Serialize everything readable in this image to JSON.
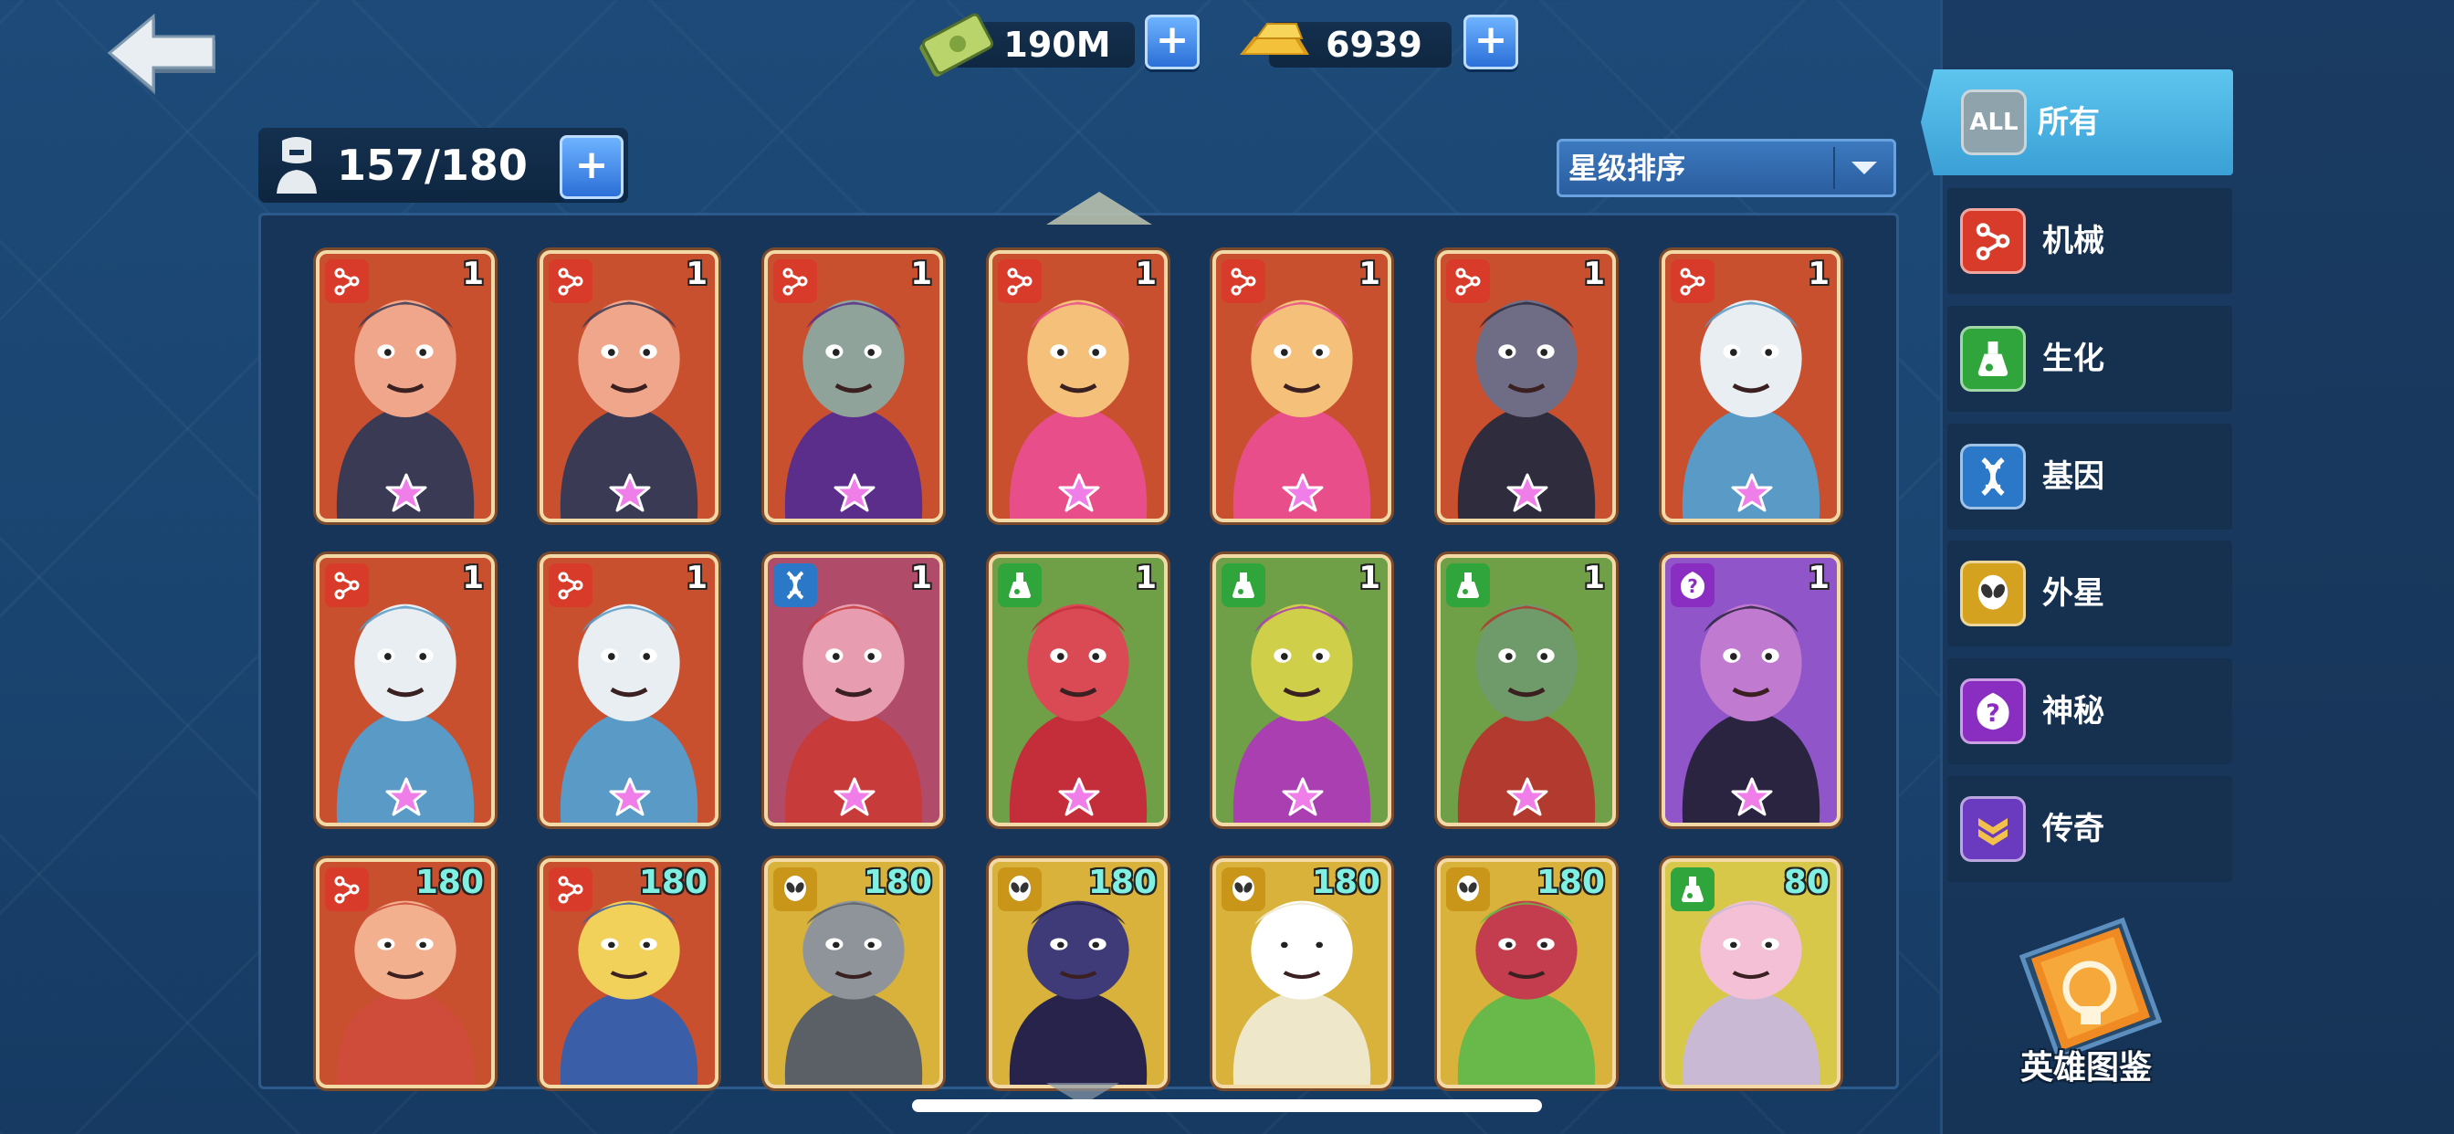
{
  "currencies": [
    {
      "name": "cash",
      "value": "190M",
      "icon": "cash-icon"
    },
    {
      "name": "gold",
      "value": "6939",
      "icon": "gold-bars-icon"
    }
  ],
  "capacity": {
    "value": "157/180",
    "icon": "hero-bust-icon"
  },
  "sort": {
    "label": "星级排序"
  },
  "tabs": [
    {
      "id": "all",
      "label": "所有",
      "icon": "all-icon",
      "icon_text": "ALL",
      "color": "#8fa3ad",
      "active": true
    },
    {
      "id": "mech",
      "label": "机械",
      "icon": "mech-icon",
      "color": "#d93b2b"
    },
    {
      "id": "bio",
      "label": "生化",
      "icon": "flask-icon",
      "color": "#2fa53b"
    },
    {
      "id": "gene",
      "label": "基因",
      "icon": "dna-icon",
      "color": "#2b78c9"
    },
    {
      "id": "alien",
      "label": "外星",
      "icon": "alien-icon",
      "color": "#d4a21e"
    },
    {
      "id": "mystic",
      "label": "神秘",
      "icon": "mystery-icon",
      "color": "#8a2dc1"
    },
    {
      "id": "legend",
      "label": "传奇",
      "icon": "legend-icon",
      "color": "#6b3bbf"
    }
  ],
  "codex": {
    "label": "英雄图鉴"
  },
  "cards": [
    {
      "faction": "mech",
      "level": "1",
      "bg": "#c8502f",
      "art": "#3b3a55",
      "skin": "#f0a68a"
    },
    {
      "faction": "mech",
      "level": "1",
      "bg": "#c8502f",
      "art": "#3b3a55",
      "skin": "#f0a68a"
    },
    {
      "faction": "mech",
      "level": "1",
      "bg": "#c8502f",
      "art": "#5a2e8a",
      "skin": "#8fa39a"
    },
    {
      "faction": "mech",
      "level": "1",
      "bg": "#c8502f",
      "art": "#e84f8a",
      "skin": "#f4c07a"
    },
    {
      "faction": "mech",
      "level": "1",
      "bg": "#c8502f",
      "art": "#e84f8a",
      "skin": "#f4c07a"
    },
    {
      "faction": "mech",
      "level": "1",
      "bg": "#c8502f",
      "art": "#2e2c3d",
      "skin": "#6f6d86"
    },
    {
      "faction": "mech",
      "level": "1",
      "bg": "#c8502f",
      "art": "#5a9ac6",
      "skin": "#e8eef2"
    },
    {
      "faction": "mech",
      "level": "1",
      "bg": "#c8502f",
      "art": "#5a9ac6",
      "skin": "#e8eef2"
    },
    {
      "faction": "mech",
      "level": "1",
      "bg": "#c8502f",
      "art": "#5a9ac6",
      "skin": "#e8eef2"
    },
    {
      "faction": "gene",
      "level": "1",
      "bg": "#b04c6a",
      "art": "#c73b3b",
      "skin": "#e89cb0"
    },
    {
      "faction": "bio",
      "level": "1",
      "bg": "#6fa047",
      "art": "#c42e3a",
      "skin": "#d94a55"
    },
    {
      "faction": "bio",
      "level": "1",
      "bg": "#6fa047",
      "art": "#a93fb0",
      "skin": "#cfcf4a"
    },
    {
      "faction": "bio",
      "level": "1",
      "bg": "#6fa047",
      "art": "#b23a2e",
      "skin": "#6f9a6a"
    },
    {
      "faction": "mystic",
      "level": "1",
      "bg": "#8f55c9",
      "art": "#2b2440",
      "skin": "#c07ad0"
    },
    {
      "faction": "mech",
      "level": "180",
      "bg": "#c8502f",
      "art": "#cf4b3a",
      "skin": "#f2b08e"
    },
    {
      "faction": "mech",
      "level": "180",
      "bg": "#c8502f",
      "art": "#3a5fa8",
      "skin": "#f2d15a"
    },
    {
      "faction": "alien",
      "level": "180",
      "bg": "#d8b23a",
      "art": "#5b5f66",
      "skin": "#8e949a"
    },
    {
      "faction": "alien",
      "level": "180",
      "bg": "#d8b23a",
      "art": "#27234a",
      "skin": "#3f3a78"
    },
    {
      "faction": "alien",
      "level": "180",
      "bg": "#d8b23a",
      "art": "#eee7c9",
      "skin": "#ffffff"
    },
    {
      "faction": "alien",
      "level": "180",
      "bg": "#d8b23a",
      "art": "#69b84a",
      "skin": "#c43d4e"
    },
    {
      "faction": "bio",
      "level": "80",
      "bg": "#d8c84a",
      "art": "#c9b9d4",
      "skin": "#f3c0d6"
    }
  ],
  "faction_colors": {
    "mech": "#d93b2b",
    "bio": "#2fa53b",
    "gene": "#2b78c9",
    "alien": "#c9961a",
    "mystic": "#8a2dc1"
  }
}
